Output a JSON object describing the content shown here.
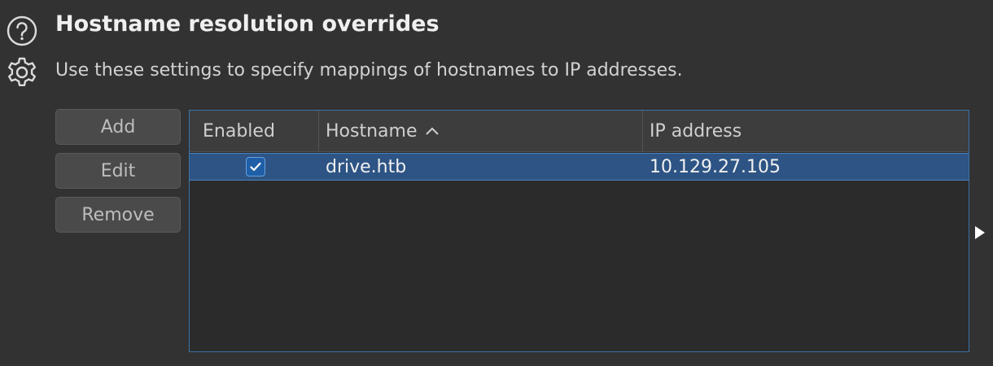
{
  "section": {
    "title": "Hostname resolution overrides",
    "description": "Use these settings to specify mappings of hostnames to IP addresses."
  },
  "icons": {
    "help": "help-circle-icon",
    "settings": "gear-icon",
    "expand": "right-triangle-arrow-icon",
    "sort": "chevron-up-icon",
    "check": "checkmark-icon"
  },
  "buttons": {
    "add": "Add",
    "edit": "Edit",
    "remove": "Remove"
  },
  "table": {
    "columns": [
      "Enabled",
      "Hostname",
      "IP address"
    ],
    "sorted_column": "Hostname",
    "sort_direction": "ascending",
    "rows": [
      {
        "enabled": true,
        "hostname": "drive.htb",
        "ip": "10.129.27.105",
        "selected": true
      }
    ]
  },
  "colors": {
    "background": "#323232",
    "selection": "#2d5484",
    "accent": "#3a73a6",
    "checkbox": "#1f5fa8"
  }
}
